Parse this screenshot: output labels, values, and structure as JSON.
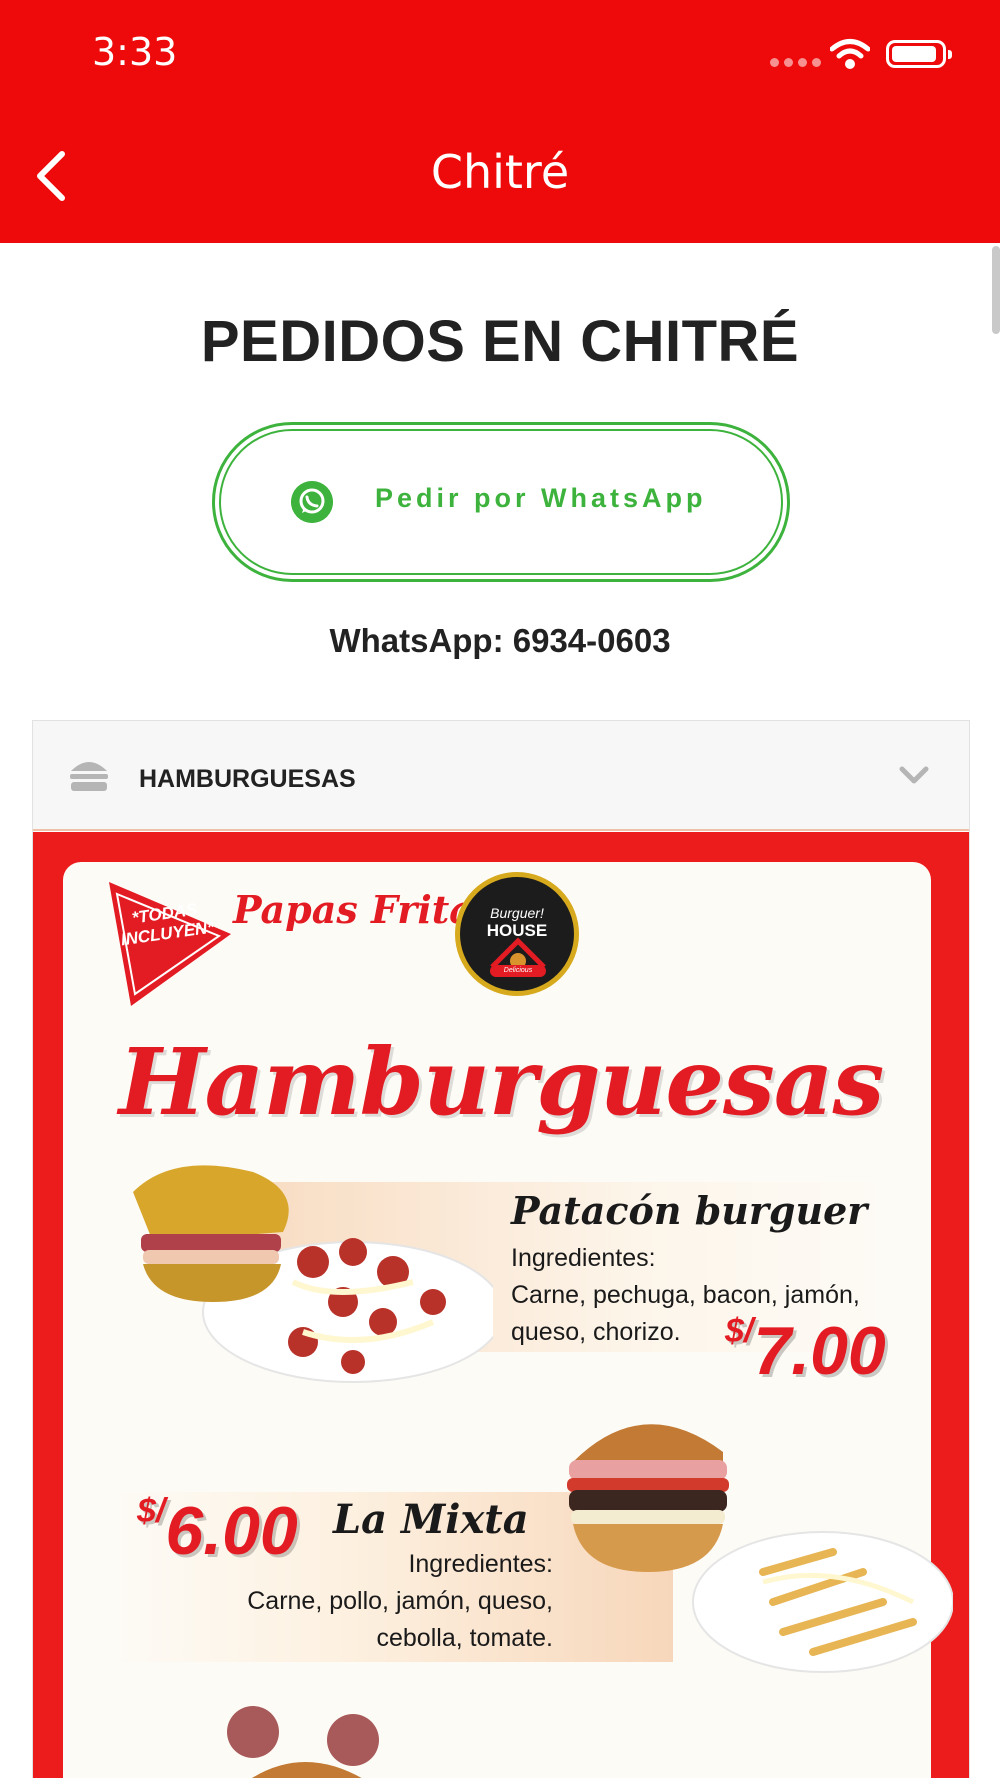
{
  "status_bar": {
    "time": "3:33"
  },
  "nav": {
    "title": "Chitré",
    "back_icon": "chevron-left-icon"
  },
  "page": {
    "title": "PEDIDOS EN CHITRÉ",
    "whatsapp_button_label": "Pedir por WhatsApp",
    "whatsapp_number": "WhatsApp: 6934-0603"
  },
  "accordion": {
    "label": "HAMBURGUESAS",
    "icon": "hamburger-icon",
    "expanded": true
  },
  "menu_image": {
    "promo": "*TODAS INCLUYEN*",
    "promo_script": "Papas Fritas",
    "logo_top": "Burguer!",
    "logo_house": "HOUSE",
    "logo_bottom": "Delicious",
    "heading": "Hamburguesas",
    "items": [
      {
        "name": "Patacón burguer",
        "ingredients_label": "Ingredientes:",
        "ingredients_line1": "Carne, pechuga, bacon, jamón,",
        "ingredients_line2": "queso, chorizo.",
        "currency": "$/",
        "price": "7.00"
      },
      {
        "name": "La Mixta",
        "ingredients_label": "Ingredientes:",
        "ingredients_line1": "Carne, pollo, jamón, queso,",
        "ingredients_line2": "cebolla, tomate.",
        "currency": "$/",
        "price": "6.00"
      }
    ]
  },
  "colors": {
    "brand_red": "#ee0a0a",
    "whatsapp_green": "#3db33d"
  }
}
